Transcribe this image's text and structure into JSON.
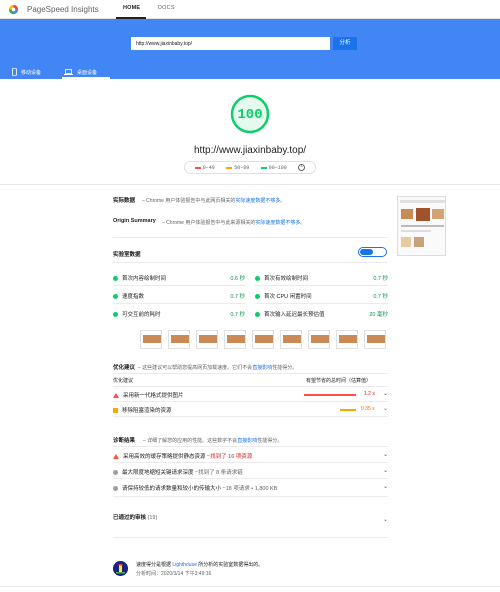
{
  "header": {
    "app_title": "PageSpeed Insights",
    "tabs": [
      {
        "label": "HOME"
      },
      {
        "label": "DOCS"
      }
    ]
  },
  "search": {
    "url_value": "http://www.jiaxinbaby.top/",
    "analyze_label": "分析"
  },
  "devices": [
    {
      "label": "移动设备"
    },
    {
      "label": "桌面设备"
    }
  ],
  "score": {
    "value": "100",
    "url": "http://www.jiaxinbaby.top/",
    "legend": [
      "0–49",
      "50–89",
      "90–100"
    ],
    "info": "i"
  },
  "field_data": {
    "title": "实际数据",
    "dash": "–",
    "desc": "Chrome 用户体验报告中与此网页相关的",
    "link": "实际速度数据不够多",
    "end": "。"
  },
  "origin_summary": {
    "title": "Origin Summary",
    "dash": "–",
    "desc": "Chrome 用户体验报告中与此来源相关的",
    "link": "实际速度数据不够多",
    "end": "。"
  },
  "lab_data": {
    "title": "实验室数据",
    "metrics_left": [
      {
        "label": "首次内容绘制时间",
        "value": "0.6 秒"
      },
      {
        "label": "速度指数",
        "value": "0.7 秒"
      },
      {
        "label": "可交互前的耗时",
        "value": "0.7 秒"
      }
    ],
    "metrics_right": [
      {
        "label": "首次有效绘制时间",
        "value": "0.7 秒"
      },
      {
        "label": "首次 CPU 闲置时间",
        "value": "0.7 秒"
      },
      {
        "label": "首次输入延迟最长预估值",
        "value": "20 毫秒"
      }
    ]
  },
  "opportunities": {
    "title": "优化建议",
    "desc": "– 这些建议可以帮助您提高网页加载速度。它们不会",
    "link": "直接影响",
    "desc_end": "性能得分。",
    "col1": "优化建议",
    "col2": "有望节省的总时间（估算值）",
    "items": [
      {
        "label": "采用新一代格式提供图片",
        "value": "1.2 s"
      },
      {
        "label": "移除阻塞渲染的资源",
        "value": "0.35 s"
      }
    ]
  },
  "diagnostics": {
    "title": "诊断结果",
    "desc": "– 详细了解您的应用的性能。这些数字不会",
    "link": "直接影响",
    "desc_end": "性能得分。",
    "items": [
      {
        "label": "采用高效的缓存策略提供静态资源",
        "sep": "– ",
        "detail": "找到了 16 项资源"
      },
      {
        "label": "最大限度地缩短关键请求深度",
        "sep": "– ",
        "detail": "找到了 8 条请求链"
      },
      {
        "label": "请保持较低的请求数量和较小的传输大小",
        "sep": "– ",
        "detail": "18 项请求 • 1,800 KB"
      }
    ]
  },
  "passed": {
    "title": "已通过的审核",
    "count": "(19)"
  },
  "footer": {
    "line1": "速度得分是根据",
    "link": "Lighthouse",
    "line1_end": "所分析的实验室数据得出的。",
    "line2": "分析时间：2020/3/14 下午3:49:16"
  },
  "colors": {
    "brand": "#4285f4",
    "good": "#0cce6b",
    "average": "#ffa400",
    "poor": "#ff4e42"
  }
}
